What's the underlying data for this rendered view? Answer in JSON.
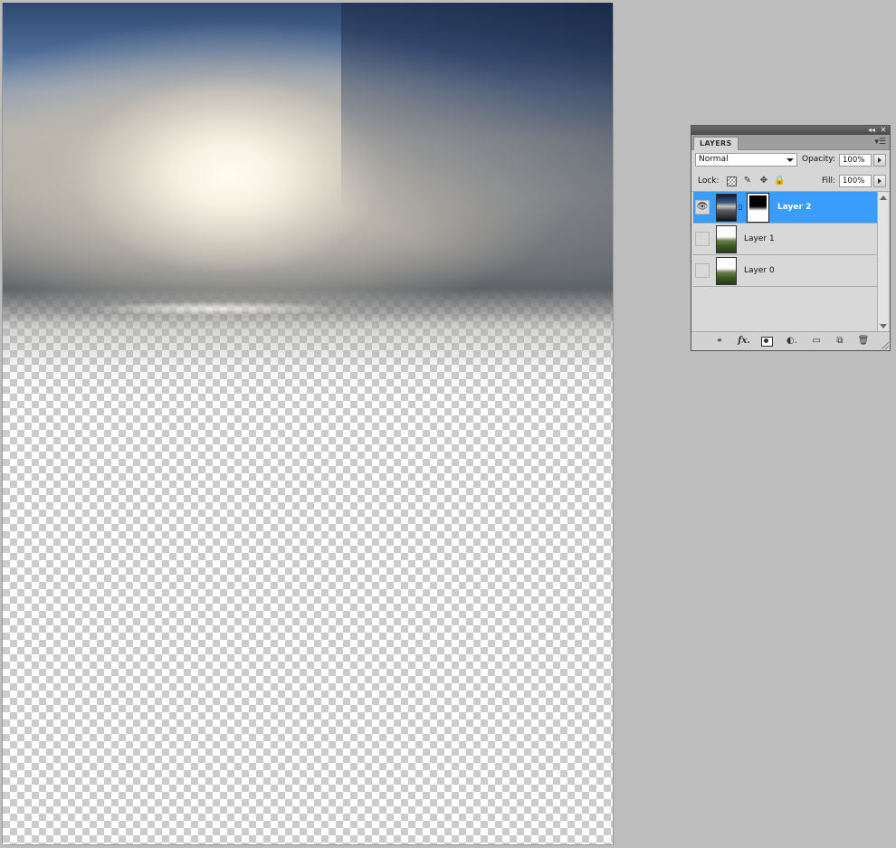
{
  "layers_panel": {
    "tab_label": "LAYERS",
    "collapse_glyph": "◂◂",
    "close_glyph": "✕",
    "menu_glyph": "▾☰",
    "blend_mode": "Normal",
    "opacity_label": "Opacity:",
    "opacity_value": "100%",
    "lock_label": "Lock:",
    "fill_label": "Fill:",
    "fill_value": "100%",
    "layers": [
      {
        "name": "Layer 2",
        "visible": true,
        "selected": true,
        "has_mask": true
      },
      {
        "name": "Layer 1",
        "visible": false,
        "selected": false,
        "has_mask": false
      },
      {
        "name": "Layer 0",
        "visible": false,
        "selected": false,
        "has_mask": false
      }
    ],
    "footer": {
      "link_glyph": "⚭",
      "fx_glyph": "fx.",
      "adjust_glyph": "◐.",
      "group_glyph": "▭",
      "new_glyph": "⧉",
      "trash_glyph": "🗑"
    },
    "eye_glyph": "👁",
    "chain_glyph": "⛓",
    "selection_color": "#3a9dfb"
  }
}
